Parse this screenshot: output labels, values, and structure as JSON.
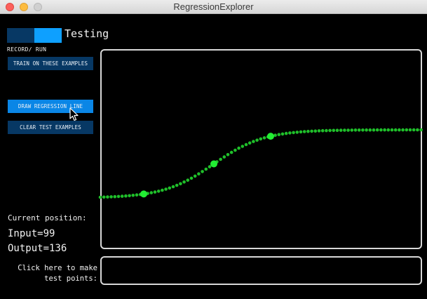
{
  "window": {
    "title": "RegressionExplorer"
  },
  "mode": {
    "label": "Testing",
    "toggle_caption": "RECORD/ RUN",
    "toggle_state": "run"
  },
  "buttons": {
    "train": "TRAIN ON THESE EXAMPLES",
    "draw": "DRAW REGRESSION LINE",
    "clear": "CLEAR TEST EXAMPLES"
  },
  "position": {
    "heading": "Current position:",
    "input": "Input=99",
    "output": "Output=136"
  },
  "test_area": {
    "hint_line1": "Click here to make",
    "hint_line2": "test points:"
  },
  "colors": {
    "curve": "#1fbf2a",
    "training_point": "#22ee33",
    "button": "#073864",
    "button_active": "#0a86e6",
    "toggle_on": "#0ea0ff"
  }
}
